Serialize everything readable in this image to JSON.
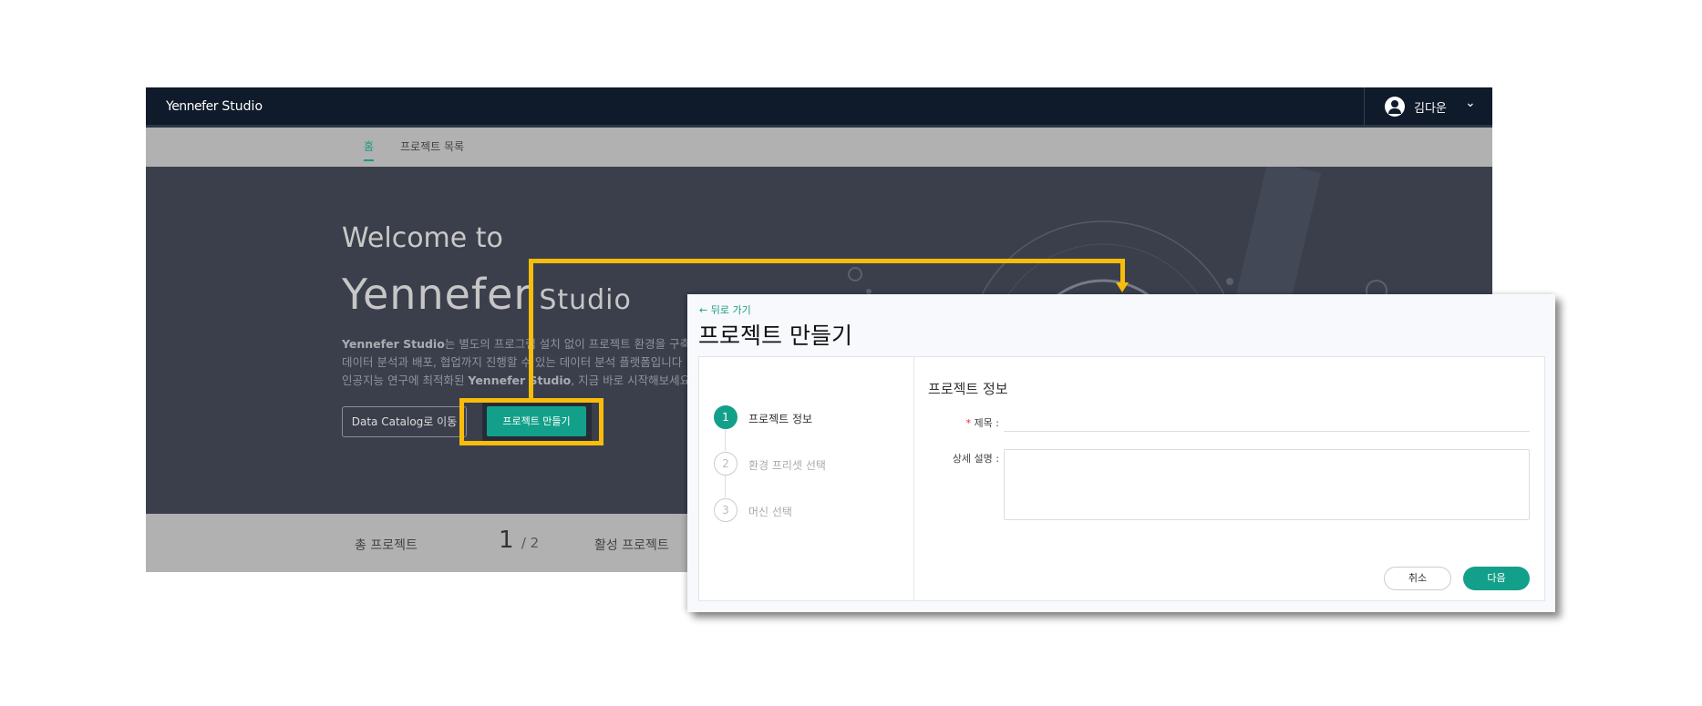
{
  "header": {
    "brand": "Yennefer",
    "brand_suffix": "Studio",
    "username": "김다운"
  },
  "tabs": [
    {
      "label": "홈",
      "active": true
    },
    {
      "label": "프로젝트 목록",
      "active": false
    }
  ],
  "hero": {
    "welcome": "Welcome to",
    "logo_main": "Yennefer",
    "logo_suffix": "Studio",
    "para_1_bold": "Yennefer Studio",
    "para_1": "는 별도의 프로그램 설치 없이 프로젝트 환경을 구축하",
    "para_2": "데이터 분석과 배포, 협업까지 진행할 수 있는 데이터 분석 플랫폼입니다",
    "para_3a": "인공지능 연구에 최적화된 ",
    "para_3_bold": "Yennefer Studio",
    "para_3b": ", 지금 바로 시작해보세요.",
    "data_catalog_button": "Data Catalog로 이동",
    "create_project_button": "프로젝트 만들기"
  },
  "stats": {
    "total_label": "총 프로젝트",
    "value": "1",
    "total": "/ 2",
    "active_label": "활성 프로젝트"
  },
  "highlight_color": "#f8bd0b",
  "accent_color": "#13a08a",
  "dialog": {
    "back": "뒤로 가기",
    "title": "프로젝트 만들기",
    "steps": [
      {
        "num": "1",
        "label": "프로젝트 정보"
      },
      {
        "num": "2",
        "label": "환경 프리셋 선택"
      },
      {
        "num": "3",
        "label": "머신 선택"
      }
    ],
    "section_title": "프로젝트 정보",
    "title_label": "제목 :",
    "required_mark": "*",
    "title_value": "",
    "desc_label": "상세 설명 :",
    "desc_value": "",
    "cancel": "취소",
    "next": "다음"
  }
}
